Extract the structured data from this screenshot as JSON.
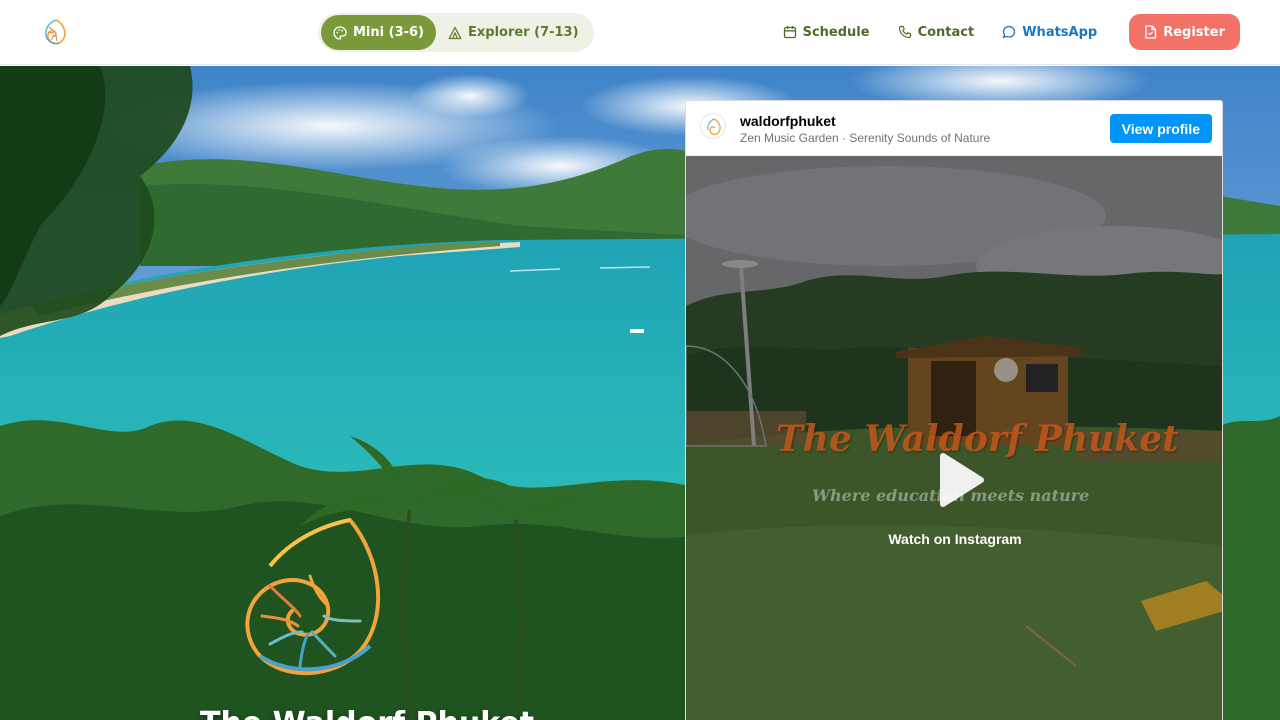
{
  "header": {
    "logo_icon": "nautilus-shell-logo-icon",
    "age_toggle": [
      {
        "label": "Mini (3-6)",
        "icon": "palette-icon",
        "active": true
      },
      {
        "label": "Explorer (7-13)",
        "icon": "tent-icon",
        "active": false
      }
    ],
    "nav": {
      "schedule": "Schedule",
      "contact": "Contact",
      "whatsapp": "WhatsApp",
      "register": "Register"
    },
    "colors": {
      "green": "#7a9a3a",
      "register": "#f27268",
      "whatsapp": "#1a78c2"
    }
  },
  "hero": {
    "title": "The Waldorf Phuket",
    "logo_icon": "nautilus-shell-icon"
  },
  "instagram": {
    "username": "waldorfphuket",
    "subtitle": "Zen Music Garden · Serenity Sounds of Nature",
    "view_profile": "View profile",
    "overlay_title": "The Waldorf Phuket",
    "overlay_tagline": "Where education meets nature",
    "watch_label": "Watch on Instagram",
    "button_color": "#0095f6"
  }
}
